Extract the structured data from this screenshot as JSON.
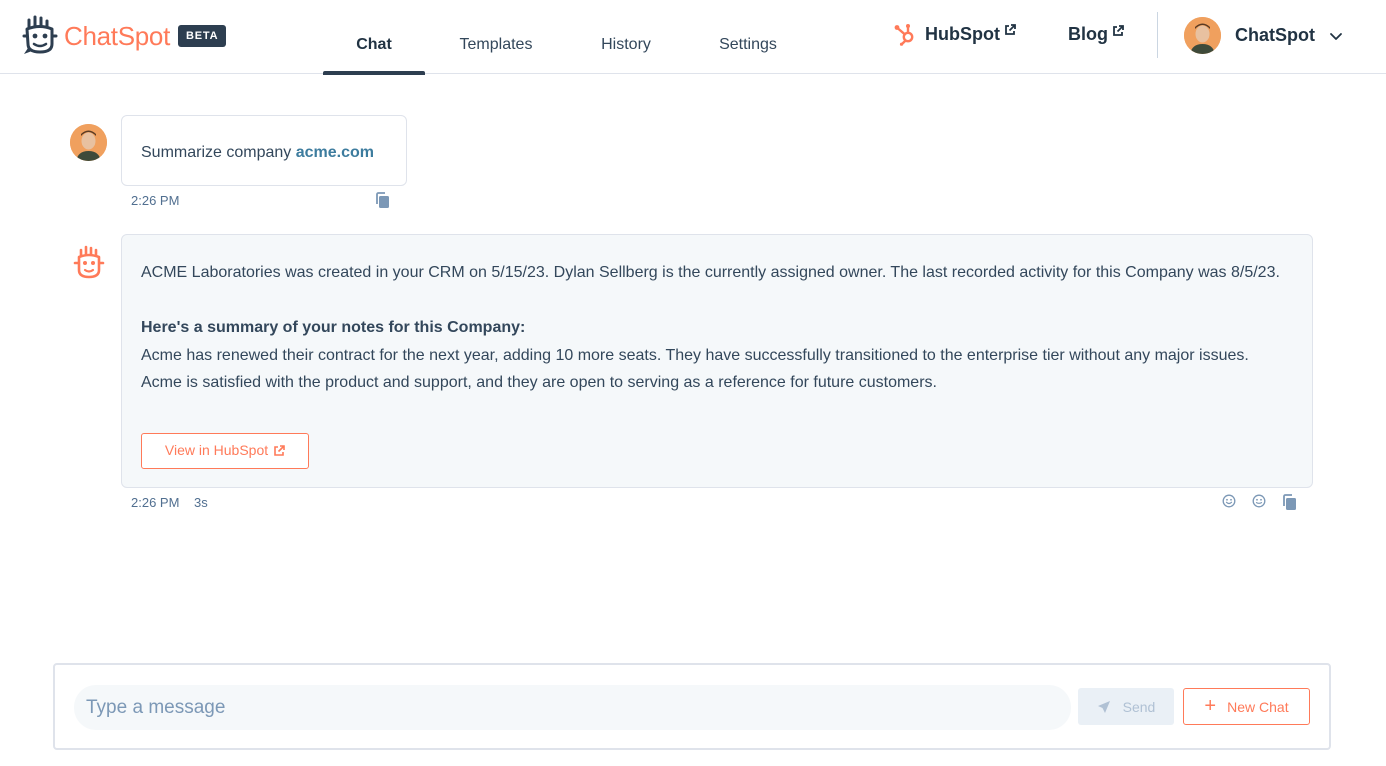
{
  "header": {
    "logo_text": "ChatSpot",
    "beta_badge": "BETA",
    "tabs": [
      {
        "label": "Chat",
        "active": true
      },
      {
        "label": "Templates",
        "active": false
      },
      {
        "label": "History",
        "active": false
      },
      {
        "label": "Settings",
        "active": false
      }
    ],
    "hubspot_link": "HubSpot",
    "blog_link": "Blog",
    "user_name": "ChatSpot"
  },
  "chat": {
    "user_message": {
      "prefix": "Summarize company ",
      "link": "acme.com",
      "time": "2:26 PM"
    },
    "bot_message": {
      "paragraph_1": "ACME Laboratories was created in your CRM on 5/15/23. Dylan Sellberg is the currently assigned owner. The last recorded activity for this Company was 8/5/23.",
      "summary_heading": "Here's a summary of your notes for this Company:",
      "paragraph_2": "Acme has renewed their contract for the next year, adding 10 more seats. They have successfully transitioned to the enterprise tier without any major issues. Acme is satisfied with the product and support, and they are open to serving as a reference for future customers.",
      "button_label": "View in HubSpot",
      "time": "2:26 PM",
      "duration": "3s"
    }
  },
  "composer": {
    "placeholder": "Type a message",
    "send_label": "Send",
    "new_chat_label": "New Chat"
  },
  "colors": {
    "brand_orange": "#ff7a59",
    "navy": "#2d3e50",
    "link_teal": "#3d7c9e",
    "bubble_bg": "#f5f8fa"
  },
  "icons": {
    "logo": "chatspot-logo-icon",
    "hubspot": "hubspot-sprocket-icon",
    "external": "external-link-icon",
    "chevron": "chevron-down-icon",
    "copy": "copy-icon",
    "feedback": "smiley-icon",
    "send": "paper-plane-icon",
    "add": "plus-icon"
  }
}
